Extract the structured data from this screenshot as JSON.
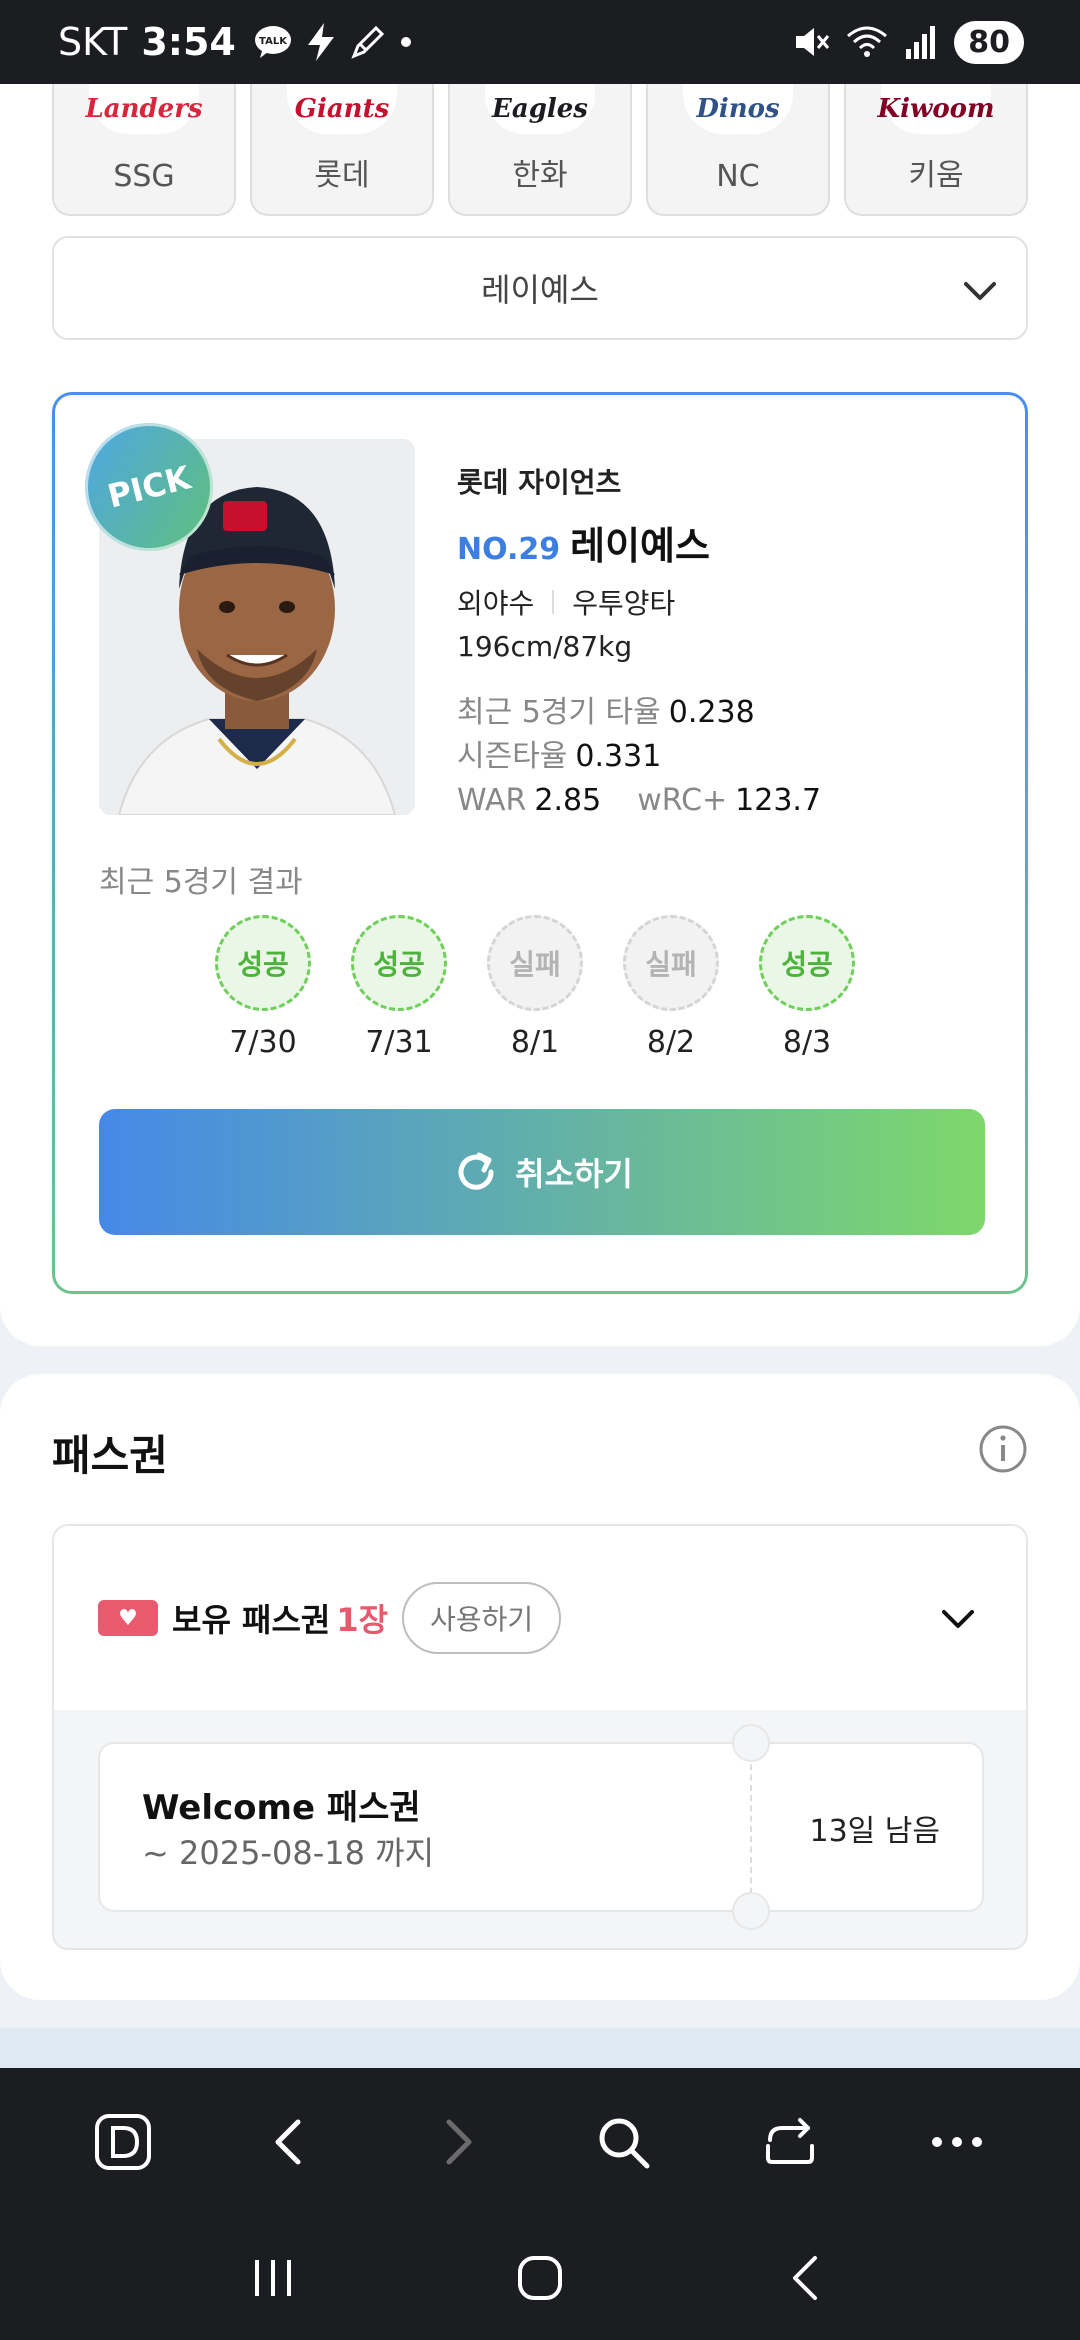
{
  "status_bar": {
    "carrier": "SKT",
    "time": "3:54",
    "battery": "80"
  },
  "teams": [
    {
      "name": "SSG",
      "logo_text": "Landers",
      "color": "#d7263d"
    },
    {
      "name": "롯데",
      "logo_text": "Giants",
      "color": "#c8102e"
    },
    {
      "name": "한화",
      "logo_text": "Eagles",
      "color": "#f37321"
    },
    {
      "name": "NC",
      "logo_text": "Dinos",
      "color": "#315288"
    },
    {
      "name": "키움",
      "logo_text": "Kiwoom",
      "color": "#820024"
    }
  ],
  "player_select": {
    "selected": "레이예스"
  },
  "pick_card": {
    "badge": "PICK",
    "team": "롯데 자이언츠",
    "number": "NO.29",
    "name": "레이예스",
    "position": "외야수",
    "hand": "우투양타",
    "body": "196cm/87kg",
    "stats": {
      "recent5_label": "최근 5경기 타율",
      "recent5_value": "0.238",
      "season_label": "시즌타율",
      "season_value": "0.331",
      "war_label": "WAR",
      "war_value": "2.85",
      "wrc_label": "wRC+",
      "wrc_value": "123.7"
    },
    "recent_title": "최근 5경기 결과",
    "results": [
      {
        "label": "성공",
        "date": "7/30",
        "status": "ok"
      },
      {
        "label": "성공",
        "date": "7/31",
        "status": "ok"
      },
      {
        "label": "실패",
        "date": "8/1",
        "status": "fail"
      },
      {
        "label": "실패",
        "date": "8/2",
        "status": "fail"
      },
      {
        "label": "성공",
        "date": "8/3",
        "status": "ok"
      }
    ],
    "cancel_label": "취소하기"
  },
  "pass": {
    "title": "패스권",
    "own_label": "보유 패스권",
    "own_count": "1장",
    "use_label": "사용하기",
    "coupon": {
      "title": "Welcome 패스권",
      "period": "~ 2025-08-18 까지",
      "remaining": "13일 남음"
    }
  },
  "colors": {
    "accent_blue": "#4688e8",
    "accent_green": "#7ed86b",
    "success": "#4cb33a",
    "pink": "#e8596e"
  }
}
